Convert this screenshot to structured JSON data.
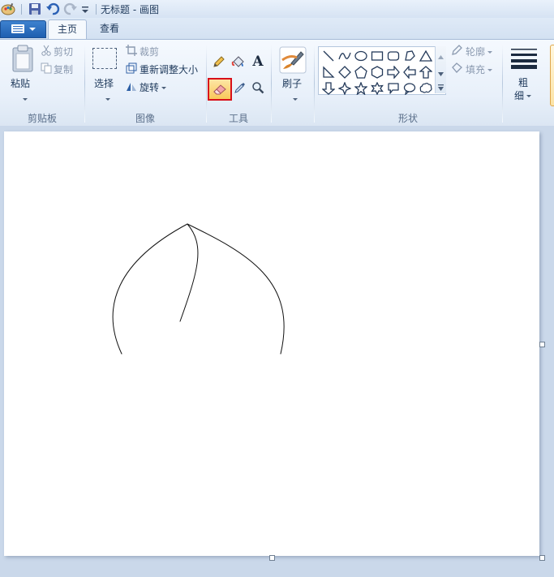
{
  "window": {
    "title": "无标题 - 画图"
  },
  "tabs": [
    {
      "label": "主页"
    },
    {
      "label": "查看"
    }
  ],
  "clipboard": {
    "paste_label": "粘贴",
    "cut_label": "剪切",
    "copy_label": "复制",
    "group_label": "剪贴板"
  },
  "image": {
    "select_label": "选择",
    "crop_label": "裁剪",
    "resize_label": "重新调整大小",
    "rotate_label": "旋转",
    "group_label": "图像"
  },
  "tools": {
    "group_label": "工具",
    "selected_tool": "eraser-icon",
    "text_glyph": "A"
  },
  "brushes": {
    "label": "刷子"
  },
  "shapes": {
    "group_label": "形状",
    "outline_label": "轮廓",
    "fill_label": "填充"
  },
  "size": {
    "label_line1": "粗",
    "label_line2": "细"
  },
  "colors": {
    "accent": "#1f5fb0",
    "selection_border": "#d8101a",
    "canvas": "#ffffff",
    "workspace": "#cad8ea"
  }
}
